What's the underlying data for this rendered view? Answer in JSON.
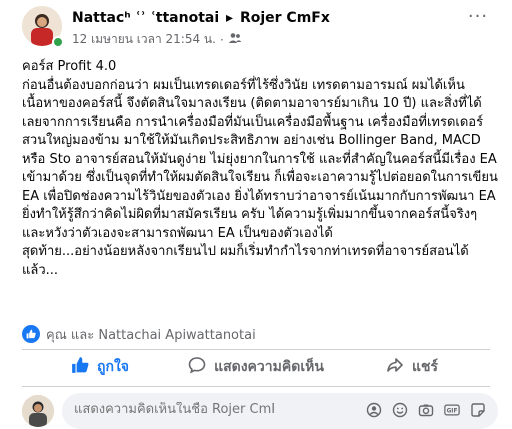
{
  "header": {
    "author": "Nattachai Apiwattanotai",
    "author_display": "Nattacʰ ʿʾ ʿttanotai",
    "separator": "▶",
    "page": "Rojer CmFx",
    "date": "12 เมษายน เวลา 21:54 น.",
    "privacy_icon": "group-icon",
    "more": "···"
  },
  "post": {
    "paragraphs": [
      "คอร์ส Profit 4.0",
      "ก่อนอื่นต้องบอกก่อนว่า ผมเป็นเทรดเดอร์ที่ไร้ซึ่งวินัย เทรดตามอารมณ์ ผมได้เห็นเนื้อหาของคอร์สนี้ จึงตัดสินใจมาลงเรียน (ติดตามอาจารย์มาเกิน 10 ปี) และสิ่งที่ได้เลยจากการเรียนคือ การนำเครื่องมือที่มันเป็นเครื่องมือพื้นฐาน เครื่องมือที่เทรดเดอร์สวนใหญ่มองข้าม มาใช้ให้มันเกิดประสิทธิภาพ อย่างเช่น Bollinger Band, MACD หรือ Sto อาจารย์สอนให้มันดูง่าย ไม่ยุ่งยากในการใช้ และที่สำคัญในคอร์สนี้มีเรื่อง EA เข้ามาด้วย ซึ่งเป็นจุดที่ทำให้ผมตัดสินใจเรียน ก็เพื่อจะเอาความรู้ไปต่อยอดในการเขียน EA เพื่อปิดช่องความไร้วินัยของตัวเอง ยิ่งได้ทราบว่าอาจารย์เน้นมากกับการพัฒนา EA ยิ่งทำให้รู้สึกว่าคิดไม่ผิดที่มาสมัครเรียน ครับ ได้ความรู้เพิ่มมากขึ้นจากคอร์สนี้จริงๆ และหวังว่าตัวเองจะสามารถพัฒนา EA เป็นของตัวเองได้",
      "สุดท้าย...อย่างน้อยหลังจากเรียนไป ผมก็เริ่มทำกำไรจากท่าเทรดที่อาจารย์สอนได้แล้ว..."
    ]
  },
  "reactions": {
    "icon": "like-icon",
    "text": "คุณ และ Nattachai Apiwattanotai"
  },
  "actions": {
    "like": "ถูกใจ",
    "comment": "แสดงความคิดเห็น",
    "share": "แชร์"
  },
  "comment_box": {
    "placeholder": "แสดงความคิดเห็นในชื่อ Rojer CmFx",
    "icons": [
      "avatar-sticker-icon",
      "camera-icon",
      "emoji-icon",
      "gif-icon",
      "sticker-icon"
    ]
  },
  "colors": {
    "accent": "#1877f2",
    "secondary_text": "#65676b",
    "online": "#31a24c"
  }
}
